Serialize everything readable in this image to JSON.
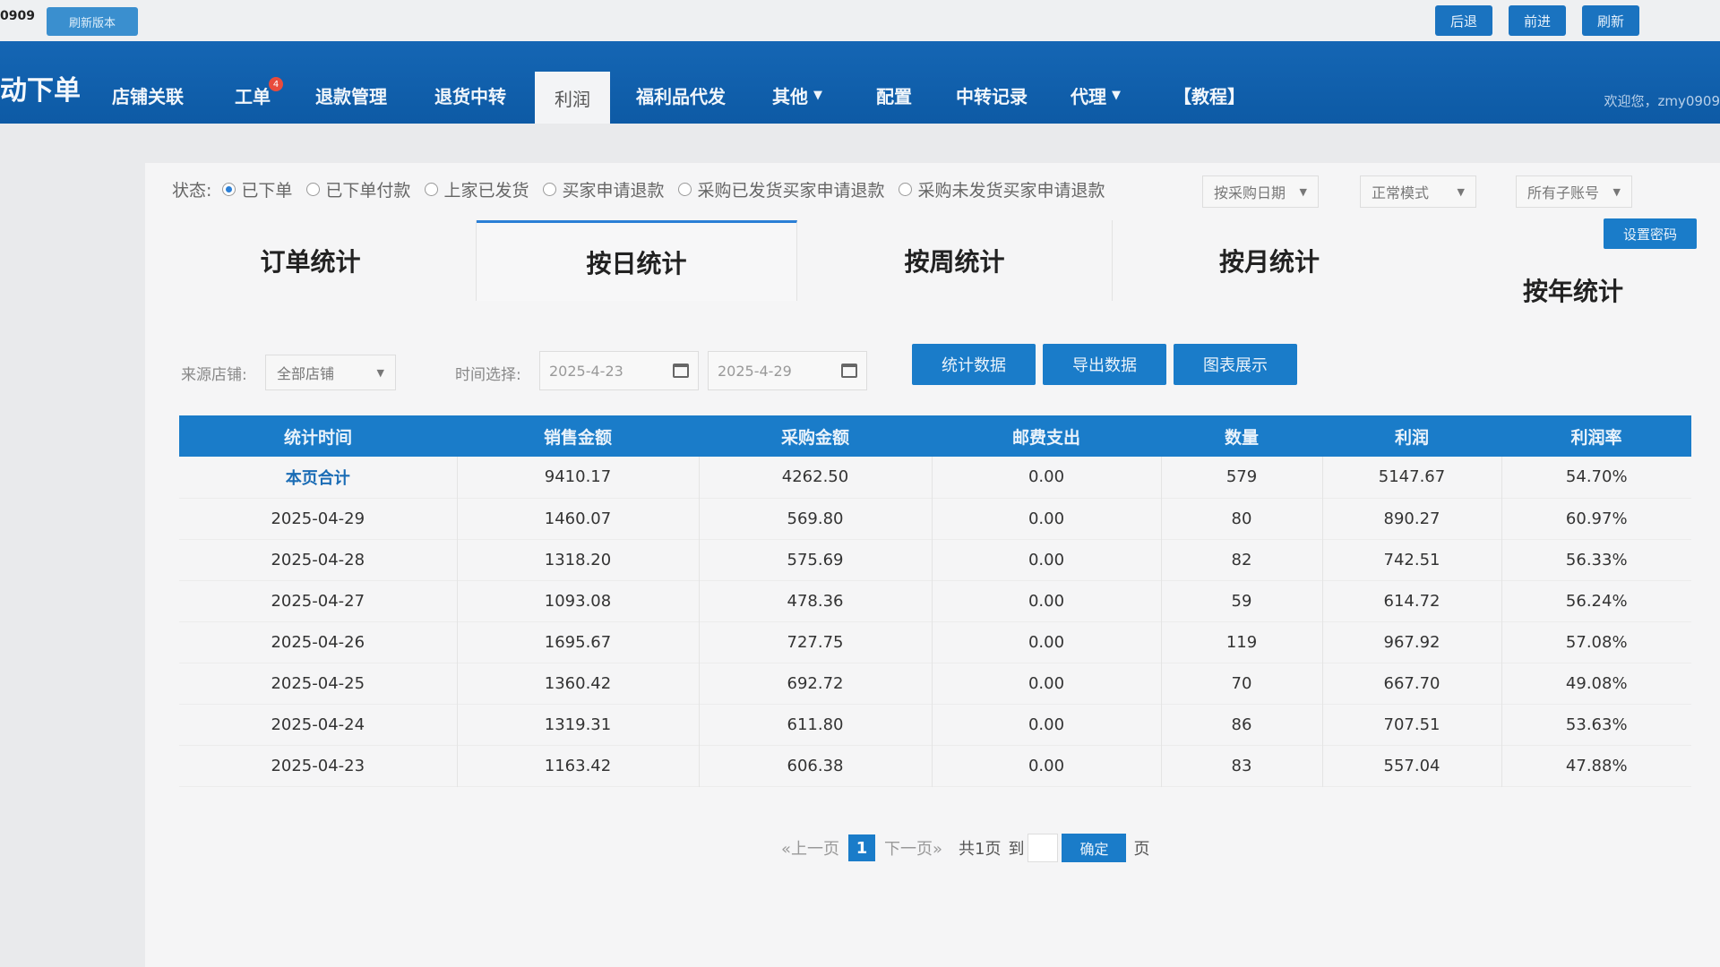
{
  "topbar": {
    "user_id": "0909",
    "refresh_label": "刷新版本",
    "back_label": "后退",
    "forward_label": "前进",
    "refresh2_label": "刷新"
  },
  "nav": {
    "brand": "动下单",
    "items": [
      "店铺关联",
      "工单",
      "退款管理",
      "退货中转",
      "利润",
      "福利品代发",
      "其他",
      "配置",
      "中转记录",
      "代理",
      "【教程】"
    ],
    "active": "利润",
    "badge": "4",
    "welcome": "欢迎您，zmy0909"
  },
  "status": {
    "label": "状态:",
    "options": [
      "已下单",
      "已下单付款",
      "上家已发货",
      "买家申请退款",
      "采购已发货买家申请退款",
      "采购未发货买家申请退款"
    ],
    "selected": "已下单",
    "date_mode": "按采购日期",
    "mode": "正常模式",
    "account": "所有子账号"
  },
  "set_password_label": "设置密码",
  "tabs": [
    "订单统计",
    "按日统计",
    "按周统计",
    "按月统计",
    "按年统计"
  ],
  "active_tab": "按日统计",
  "filters": {
    "shop_label": "来源店铺:",
    "shop_value": "全部店铺",
    "time_label": "时间选择:",
    "start_date": "2025-4-23",
    "end_date": "2025-4-29",
    "btn_stats": "统计数据",
    "btn_export": "导出数据",
    "btn_chart": "图表展示"
  },
  "table": {
    "headers": [
      "统计时间",
      "销售金额",
      "采购金额",
      "邮费支出",
      "数量",
      "利润",
      "利润率"
    ],
    "rows": [
      [
        "本页合计",
        "9410.17",
        "4262.50",
        "0.00",
        "579",
        "5147.67",
        "54.70%"
      ],
      [
        "2025-04-29",
        "1460.07",
        "569.80",
        "0.00",
        "80",
        "890.27",
        "60.97%"
      ],
      [
        "2025-04-28",
        "1318.20",
        "575.69",
        "0.00",
        "82",
        "742.51",
        "56.33%"
      ],
      [
        "2025-04-27",
        "1093.08",
        "478.36",
        "0.00",
        "59",
        "614.72",
        "56.24%"
      ],
      [
        "2025-04-26",
        "1695.67",
        "727.75",
        "0.00",
        "119",
        "967.92",
        "57.08%"
      ],
      [
        "2025-04-25",
        "1360.42",
        "692.72",
        "0.00",
        "70",
        "667.70",
        "49.08%"
      ],
      [
        "2025-04-24",
        "1319.31",
        "611.80",
        "0.00",
        "86",
        "707.51",
        "53.63%"
      ],
      [
        "2025-04-23",
        "1163.42",
        "606.38",
        "0.00",
        "83",
        "557.04",
        "47.88%"
      ]
    ]
  },
  "pager": {
    "prev": "«上一页",
    "current": "1",
    "next": "下一页»",
    "total": "共1页",
    "goto": "到",
    "confirm": "确定",
    "page_unit": "页"
  }
}
